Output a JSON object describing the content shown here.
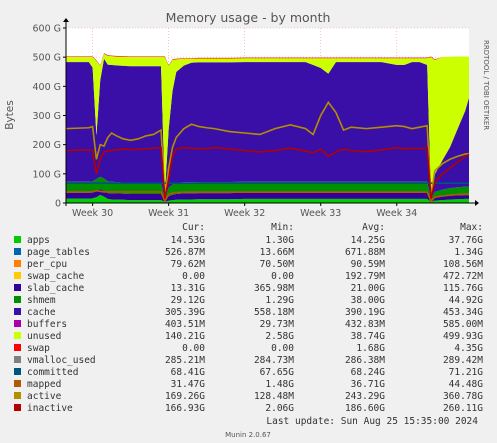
{
  "chart_data": {
    "type": "area",
    "title": "Memory usage - by month",
    "ylabel": "Bytes",
    "side_label": "RRDTOOL / TOBI OETIKER",
    "y_ticks": [
      "0",
      "100 G",
      "200 G",
      "300 G",
      "400 G",
      "500 G",
      "600 G"
    ],
    "ylim": [
      0,
      600
    ],
    "y_unit": "G",
    "x_ticks": [
      "Week 30",
      "Week 31",
      "Week 32",
      "Week 33",
      "Week 34"
    ],
    "x_range_weeks": [
      29.65,
      34.95
    ],
    "grid": true,
    "columns": [
      "Cur:",
      "Min:",
      "Avg:",
      "Max:"
    ],
    "series": [
      {
        "name": "apps",
        "color": "#00cc00",
        "cur": "14.53G",
        "min": "1.30G",
        "avg": "14.25G",
        "max": "37.76G"
      },
      {
        "name": "page_tables",
        "color": "#0066b3",
        "cur": "526.87M",
        "min": "13.66M",
        "avg": "671.88M",
        "max": "1.34G"
      },
      {
        "name": "per_cpu",
        "color": "#ff8000",
        "cur": "79.62M",
        "min": "70.50M",
        "avg": "90.59M",
        "max": "108.56M"
      },
      {
        "name": "swap_cache",
        "color": "#ffcc00",
        "cur": "0.00",
        "min": "0.00",
        "avg": "192.79M",
        "max": "472.72M"
      },
      {
        "name": "slab_cache",
        "color": "#330099",
        "cur": "13.31G",
        "min": "365.98M",
        "avg": "21.00G",
        "max": "115.76G"
      },
      {
        "name": "shmem",
        "color": "#008f00",
        "cur": "29.12G",
        "min": "1.29G",
        "avg": "38.00G",
        "max": "44.92G"
      },
      {
        "name": "cache",
        "color": "#3a0fa8",
        "cur": "305.39G",
        "min": "558.18M",
        "avg": "390.19G",
        "max": "453.34G"
      },
      {
        "name": "buffers",
        "color": "#aa00aa",
        "cur": "403.51M",
        "min": "29.73M",
        "avg": "432.83M",
        "max": "585.00M"
      },
      {
        "name": "unused",
        "color": "#ccff00",
        "cur": "140.21G",
        "min": "2.58G",
        "avg": "38.74G",
        "max": "499.93G"
      },
      {
        "name": "swap",
        "color": "#ff0000",
        "cur": "0.00",
        "min": "0.00",
        "avg": "1.68G",
        "max": "4.35G"
      },
      {
        "name": "vmalloc_used",
        "color": "#808080",
        "cur": "285.21M",
        "min": "284.73M",
        "avg": "286.38M",
        "max": "289.42M"
      },
      {
        "name": "committed",
        "color": "#005580",
        "cur": "68.41G",
        "min": "67.65G",
        "avg": "68.24G",
        "max": "71.21G"
      },
      {
        "name": "mapped",
        "color": "#b35900",
        "cur": "31.47G",
        "min": "1.48G",
        "avg": "36.71G",
        "max": "44.48G"
      },
      {
        "name": "active",
        "color": "#b38f00",
        "cur": "169.26G",
        "min": "128.48M",
        "avg": "243.29G",
        "max": "360.78G"
      },
      {
        "name": "inactive",
        "color": "#b30000",
        "cur": "166.93G",
        "min": "2.06G",
        "avg": "186.60G",
        "max": "260.11G"
      }
    ],
    "last_update": "Last update:  Sun Aug 25 15:35:00 2024",
    "footer": "Munin 2.0.67",
    "samples": {
      "x_weeks": [
        29.65,
        29.95,
        30.0,
        30.05,
        30.1,
        30.15,
        30.2,
        30.25,
        30.3,
        30.4,
        30.5,
        30.6,
        30.7,
        30.8,
        30.9,
        30.95,
        31.0,
        31.05,
        31.1,
        31.2,
        31.3,
        31.4,
        31.5,
        31.6,
        31.8,
        32.0,
        32.2,
        32.4,
        32.6,
        32.8,
        32.9,
        33.0,
        33.1,
        33.2,
        33.3,
        33.4,
        33.6,
        33.8,
        34.0,
        34.1,
        34.2,
        34.3,
        34.4,
        34.45,
        34.5,
        34.6,
        34.7,
        34.8,
        34.9,
        34.95
      ],
      "apps": [
        15,
        15,
        16,
        20,
        28,
        22,
        14,
        12,
        12,
        11,
        10,
        10,
        10,
        10,
        10,
        4,
        8,
        10,
        11,
        12,
        12,
        13,
        13,
        13,
        13,
        14,
        14,
        14,
        14,
        14,
        14,
        14,
        14,
        14,
        14,
        14,
        14,
        14,
        14,
        14,
        14,
        14,
        14,
        4,
        8,
        10,
        12,
        13,
        14,
        14
      ],
      "slab_cache": [
        20,
        20,
        20,
        22,
        20,
        20,
        20,
        21,
        21,
        21,
        21,
        21,
        21,
        21,
        21,
        4,
        15,
        18,
        20,
        21,
        21,
        21,
        21,
        21,
        21,
        21,
        21,
        21,
        21,
        21,
        21,
        21,
        21,
        21,
        21,
        21,
        21,
        21,
        21,
        21,
        21,
        21,
        21,
        4,
        10,
        12,
        13,
        13,
        13,
        13
      ],
      "shmem": [
        38,
        38,
        38,
        40,
        42,
        42,
        40,
        40,
        39,
        38,
        38,
        38,
        38,
        38,
        38,
        4,
        30,
        35,
        38,
        38,
        38,
        38,
        38,
        38,
        38,
        38,
        38,
        38,
        38,
        38,
        38,
        38,
        38,
        38,
        38,
        38,
        38,
        38,
        38,
        38,
        38,
        38,
        38,
        4,
        20,
        24,
        26,
        28,
        29,
        29
      ],
      "cache": [
        410,
        410,
        390,
        150,
        330,
        410,
        400,
        400,
        400,
        400,
        400,
        400,
        400,
        400,
        400,
        20,
        200,
        320,
        380,
        400,
        410,
        410,
        410,
        410,
        410,
        410,
        410,
        410,
        410,
        410,
        400,
        390,
        370,
        410,
        410,
        410,
        410,
        410,
        400,
        400,
        410,
        410,
        400,
        20,
        60,
        100,
        140,
        200,
        260,
        305
      ],
      "buffers": [
        0.4,
        0.4,
        0.4,
        0.4,
        0.4,
        0.4,
        0.4,
        0.4,
        0.4,
        0.4,
        0.4,
        0.4,
        0.4,
        0.4,
        0.4,
        0.1,
        0.4,
        0.4,
        0.4,
        0.4,
        0.4,
        0.4,
        0.4,
        0.4,
        0.4,
        0.4,
        0.4,
        0.4,
        0.4,
        0.4,
        0.4,
        0.4,
        0.4,
        0.4,
        0.4,
        0.4,
        0.4,
        0.4,
        0.4,
        0.4,
        0.4,
        0.4,
        0.4,
        0.1,
        0.4,
        0.4,
        0.4,
        0.4,
        0.4,
        0.4
      ],
      "unused": [
        17,
        17,
        36,
        255,
        50,
        17,
        30,
        30,
        30,
        31,
        31,
        31,
        31,
        31,
        31,
        468,
        217,
        107,
        43,
        23,
        13,
        13,
        13,
        13,
        13,
        13,
        13,
        13,
        13,
        13,
        23,
        33,
        53,
        13,
        13,
        13,
        13,
        13,
        23,
        23,
        13,
        13,
        23,
        468,
        392,
        354,
        310,
        248,
        186,
        140
      ],
      "swap": [
        2,
        2,
        2,
        2,
        2,
        2,
        2,
        2,
        2,
        2,
        2,
        2,
        2,
        2,
        2,
        2,
        2,
        2,
        2,
        2,
        2,
        2,
        2,
        2,
        2,
        2,
        2,
        2,
        2,
        2,
        2,
        2,
        2,
        2,
        2,
        2,
        2,
        2,
        2,
        2,
        2,
        2,
        2,
        2,
        2,
        0,
        0,
        0,
        0,
        0
      ],
      "committed": [
        68,
        68,
        68,
        68,
        68,
        68,
        68,
        68,
        68,
        68,
        68,
        68,
        68,
        68,
        68,
        68,
        68,
        68,
        68,
        68,
        68,
        68,
        68,
        68,
        68,
        68,
        68,
        68,
        68,
        68,
        68,
        68,
        68,
        68,
        68,
        68,
        68,
        68,
        68,
        68,
        68,
        68,
        68,
        68,
        68,
        68,
        68,
        68,
        68,
        68
      ],
      "mapped": [
        38,
        38,
        38,
        42,
        40,
        38,
        38,
        38,
        38,
        38,
        38,
        38,
        38,
        38,
        38,
        6,
        30,
        34,
        36,
        37,
        37,
        37,
        37,
        37,
        37,
        37,
        37,
        37,
        37,
        37,
        37,
        37,
        37,
        37,
        37,
        37,
        37,
        37,
        37,
        37,
        37,
        37,
        37,
        6,
        20,
        24,
        27,
        29,
        31,
        31
      ],
      "active": [
        255,
        258,
        262,
        150,
        200,
        195,
        225,
        240,
        232,
        220,
        215,
        220,
        230,
        235,
        250,
        20,
        120,
        190,
        225,
        255,
        270,
        262,
        258,
        255,
        245,
        240,
        235,
        255,
        268,
        255,
        235,
        300,
        345,
        310,
        250,
        260,
        255,
        260,
        265,
        262,
        255,
        260,
        265,
        20,
        110,
        135,
        150,
        160,
        168,
        169
      ],
      "inactive": [
        180,
        182,
        178,
        100,
        150,
        175,
        178,
        180,
        182,
        185,
        183,
        184,
        186,
        188,
        190,
        15,
        80,
        160,
        185,
        190,
        188,
        186,
        186,
        190,
        185,
        180,
        175,
        180,
        188,
        178,
        172,
        185,
        160,
        175,
        185,
        180,
        176,
        182,
        190,
        185,
        188,
        186,
        190,
        15,
        70,
        100,
        120,
        140,
        160,
        167
      ]
    }
  }
}
